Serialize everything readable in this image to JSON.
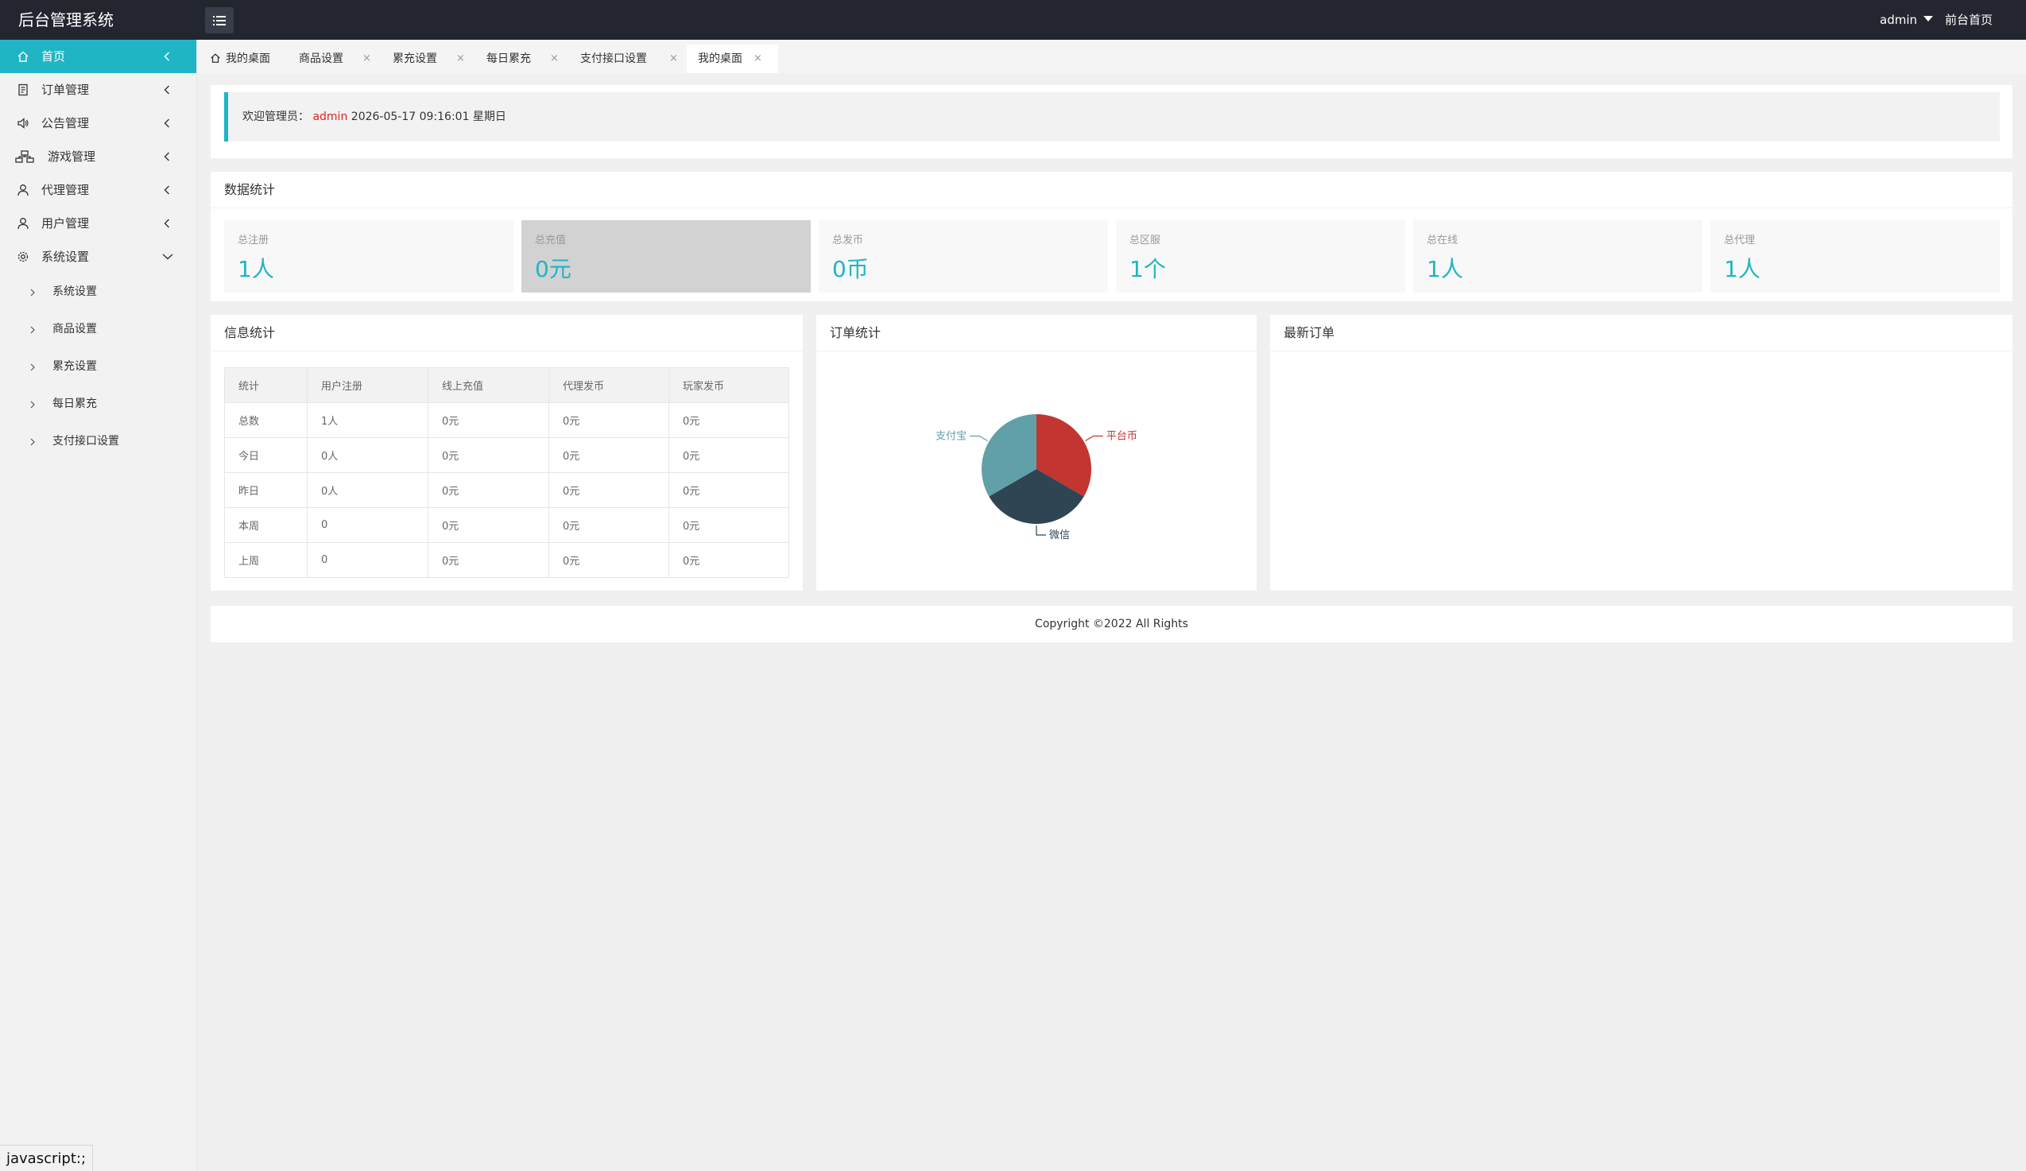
{
  "header": {
    "app_title": "后台管理系统",
    "toggle_icon": "menu-list-icon",
    "user": "admin",
    "front_link": "前台首页"
  },
  "sidebar": {
    "items": [
      {
        "label": "首页",
        "icon": "home-icon",
        "active": true
      },
      {
        "label": "订单管理",
        "icon": "order-icon"
      },
      {
        "label": "公告管理",
        "icon": "speaker-icon"
      },
      {
        "label": "游戏管理",
        "icon": "sitemap-icon"
      },
      {
        "label": "代理管理",
        "icon": "agent-icon"
      },
      {
        "label": "用户管理",
        "icon": "user-icon"
      },
      {
        "label": "系统设置",
        "icon": "gear-icon",
        "expanded": true
      }
    ],
    "sub_items": [
      "系统设置",
      "商品设置",
      "累充设置",
      "每日累充",
      "支付接口设置"
    ]
  },
  "tabs": [
    {
      "label": "我的桌面",
      "icon": "home-icon",
      "closable": false
    },
    {
      "label": "商品设置",
      "closable": true
    },
    {
      "label": "累充设置",
      "closable": true
    },
    {
      "label": "每日累充",
      "closable": true
    },
    {
      "label": "支付接口设置",
      "closable": true
    },
    {
      "label": "我的桌面",
      "closable": true,
      "current": true
    }
  ],
  "tab_close_glyph": "×",
  "welcome": {
    "prefix": "欢迎管理员：",
    "user": "admin",
    "datetime": "2026-05-17  09:16:01  星期日"
  },
  "data_stats": {
    "title": "数据统计",
    "cards": [
      {
        "label": "总注册",
        "value": "1人"
      },
      {
        "label": "总充值",
        "value": "0元"
      },
      {
        "label": "总发币",
        "value": "0币"
      },
      {
        "label": "总区服",
        "value": "1个"
      },
      {
        "label": "总在线",
        "value": "1人"
      },
      {
        "label": "总代理",
        "value": "1人"
      }
    ]
  },
  "info_stats": {
    "title": "信息统计",
    "headers": [
      "统计",
      "用户注册",
      "线上充值",
      "代理发币",
      "玩家发币"
    ],
    "rows": [
      [
        "总数",
        "1人",
        "0元",
        "0元",
        "0元"
      ],
      [
        "今日",
        "0人",
        "0元",
        "0元",
        "0元"
      ],
      [
        "昨日",
        "0人",
        "0元",
        "0元",
        "0元"
      ],
      [
        "本周",
        "0",
        "0元",
        "0元",
        "0元"
      ],
      [
        "上周",
        "0",
        "0元",
        "0元",
        "0元"
      ]
    ]
  },
  "order_stats": {
    "title": "订单统计"
  },
  "latest_orders": {
    "title": "最新订单"
  },
  "chart_data": {
    "type": "pie",
    "slices": [
      {
        "name": "平台币",
        "value": 1,
        "color": "#c23531"
      },
      {
        "name": "微信",
        "value": 1,
        "color": "#2f4554"
      },
      {
        "name": "支付宝",
        "value": 1,
        "color": "#61a0a8"
      }
    ]
  },
  "footer": {
    "copyright": "Copyright ©2022 All Rights"
  },
  "statusbar": {
    "text": "javascript:;"
  }
}
